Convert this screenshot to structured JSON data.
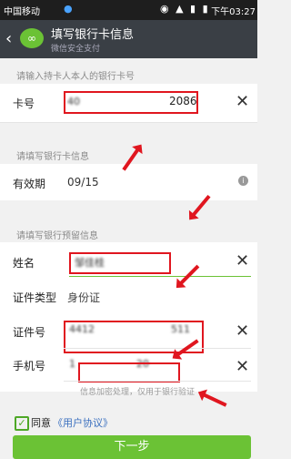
{
  "status": {
    "carrier": "中国移动",
    "time": "下午03:27",
    "icons": "◉ ▲ ▮ ▮",
    "qq_icon": "qq-icon"
  },
  "header": {
    "title": "填写银行卡信息",
    "subtitle": "微信安全支付",
    "back": "‹",
    "logo": "∞"
  },
  "card_section": {
    "label": "请输入持卡人本人的银行卡号",
    "field_label": "卡号",
    "value_start": "40",
    "value_end": "2086"
  },
  "validity_section": {
    "label": "请填写银行卡信息",
    "field_label": "有效期",
    "value": "09/15",
    "info_icon": "i"
  },
  "reserved_section": {
    "label": "请填写银行预留信息",
    "name_label": "姓名",
    "name_value": "邹佳桂",
    "id_type_label": "证件类型",
    "id_type_value": "身份证",
    "id_label": "证件号",
    "id_value": "4412",
    "id_tail": "511",
    "phone_label": "手机号",
    "phone_value": "1",
    "phone_tail": "20",
    "hint": "信息加密处理，仅用于银行验证"
  },
  "agreement": {
    "agree_text": "同意",
    "link_text": "《用户协议》"
  },
  "next_button": "下一步",
  "accent": "#6bc235",
  "annotation_color": "#e0161f"
}
